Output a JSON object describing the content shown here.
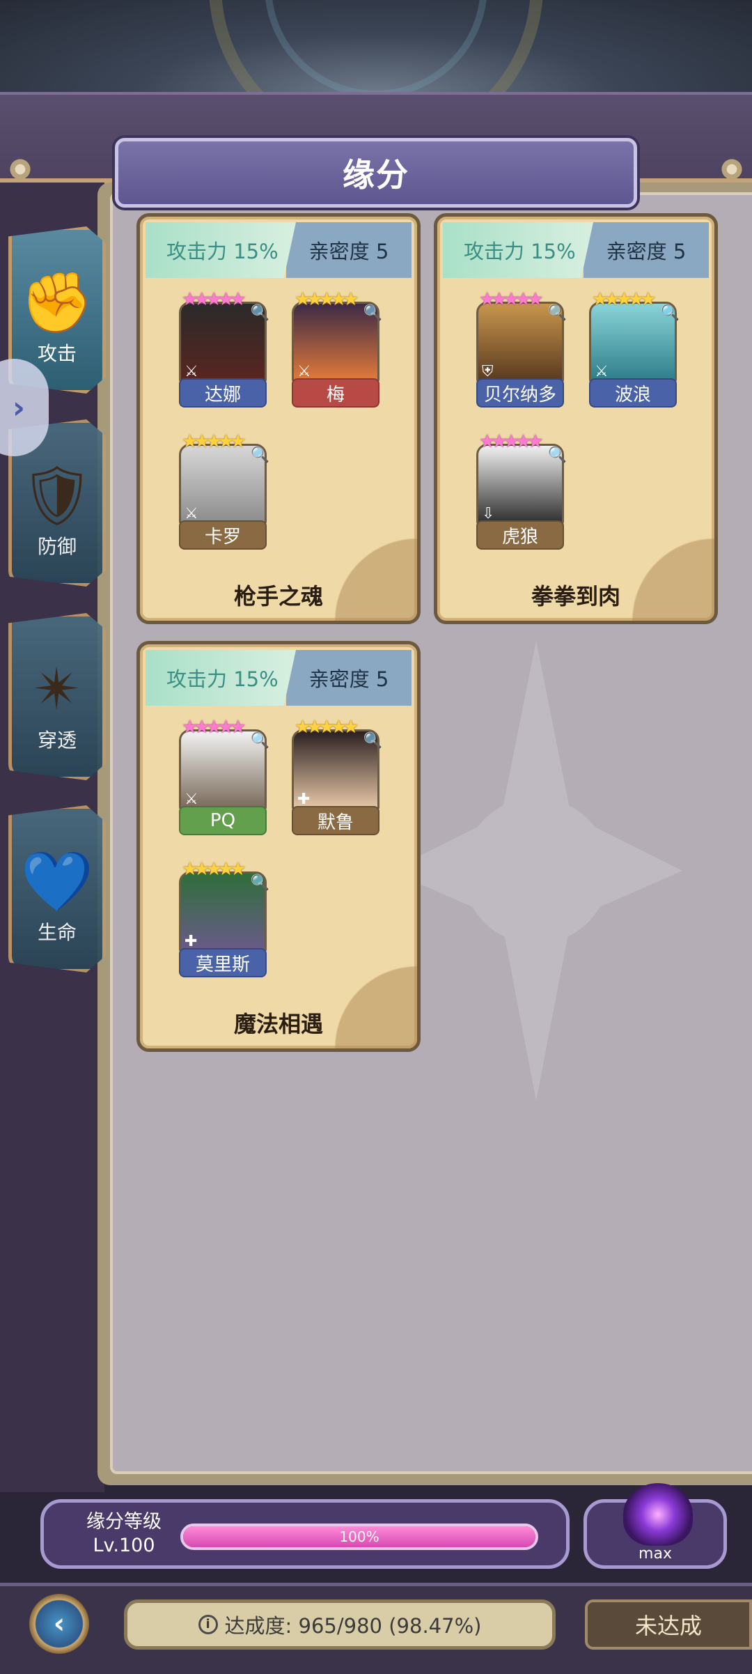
{
  "window": {
    "title": "缘分"
  },
  "tabs": [
    {
      "label": "攻击",
      "icon": "fist-icon",
      "active": true
    },
    {
      "label": "防御",
      "icon": "shield-icon",
      "active": false
    },
    {
      "label": "穿透",
      "icon": "burst-icon",
      "active": false
    },
    {
      "label": "生命",
      "icon": "heart-icon",
      "active": false
    }
  ],
  "cards": [
    {
      "stat": "攻击力 15%",
      "affinity": "亲密度 5",
      "name": "枪手之魂",
      "heroes": [
        {
          "name": "达娜",
          "label_color": "blue",
          "stars": "pink"
        },
        {
          "name": "梅",
          "label_color": "red",
          "stars": "gold"
        },
        {
          "name": "卡罗",
          "label_color": "brown",
          "stars": "gold"
        }
      ]
    },
    {
      "stat": "攻击力 15%",
      "affinity": "亲密度 5",
      "name": "拳拳到肉",
      "heroes": [
        {
          "name": "贝尔纳多",
          "label_color": "blue",
          "stars": "pink"
        },
        {
          "name": "波浪",
          "label_color": "blue",
          "stars": "gold"
        },
        {
          "name": "虎狼",
          "label_color": "brown",
          "stars": "pink"
        }
      ]
    },
    {
      "stat": "攻击力 15%",
      "affinity": "亲密度 5",
      "name": "魔法相遇",
      "heroes": [
        {
          "name": "PQ",
          "label_color": "green",
          "stars": "pink"
        },
        {
          "name": "默鲁",
          "label_color": "brown",
          "stars": "gold"
        },
        {
          "name": "莫里斯",
          "label_color": "blue",
          "stars": "gold"
        }
      ]
    }
  ],
  "level": {
    "title": "缘分等级",
    "value": "Lv.100",
    "progress_text": "100%",
    "progress_fraction": 1.0
  },
  "orb": {
    "label": "max"
  },
  "footer": {
    "achievement": "达成度: 965/980 (98.47%)",
    "status": "未达成"
  },
  "colors": {
    "accent": "#5e5690",
    "stat_text": "#3a8e84",
    "progress": "#d64ab2"
  }
}
